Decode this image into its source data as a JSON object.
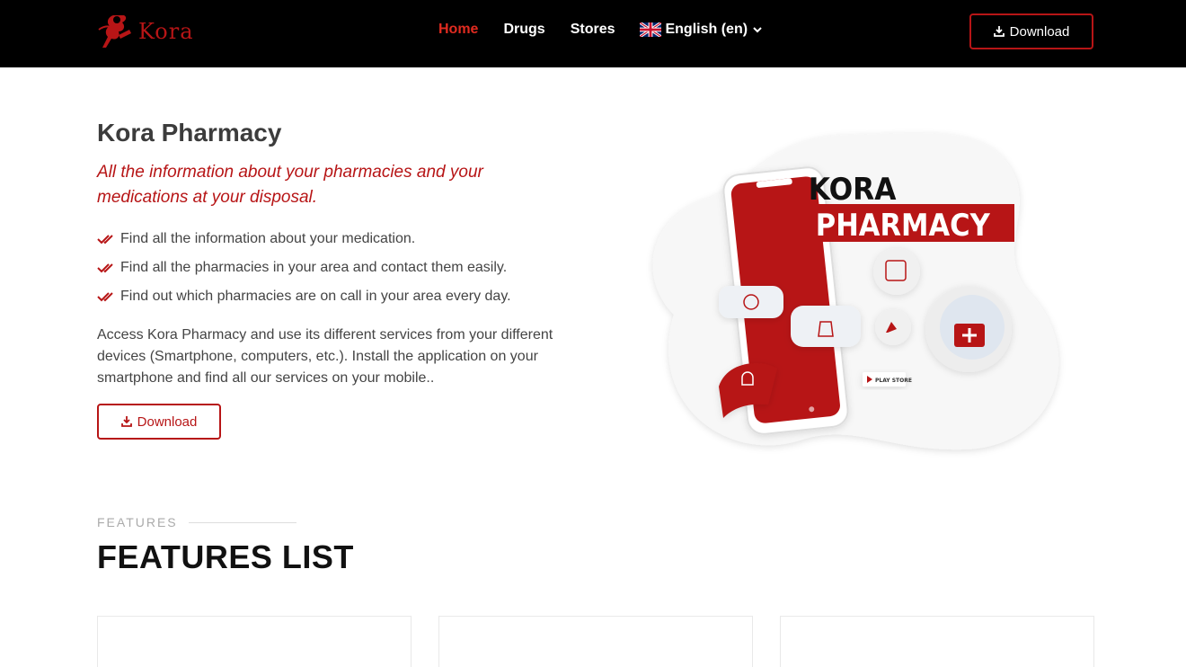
{
  "header": {
    "logo_text": "Kora",
    "nav": [
      {
        "label": "Home",
        "active": true
      },
      {
        "label": "Drugs",
        "active": false
      },
      {
        "label": "Stores",
        "active": false
      }
    ],
    "language_label": "English (en)",
    "download_label": "Download"
  },
  "hero": {
    "title": "Kora Pharmacy",
    "subtitle": "All the information about your pharmacies and your medications at your disposal.",
    "checks": [
      "Find all the information about your medication.",
      "Find all the pharmacies in your area and contact them easily.",
      "Find out which pharmacies are on call in your area every day."
    ],
    "description": "Access Kora Pharmacy and use its different services from your different devices (Smartphone, computers, etc.). Install the application on your smartphone and find all our services on your mobile..",
    "download_label": "Download"
  },
  "illustration": {
    "line1": "KORA",
    "line2": "PHARMACY",
    "store_badge": "PLAY STORE"
  },
  "features": {
    "kicker": "FEATURES",
    "title": "FEATURES LIST"
  },
  "colors": {
    "brand_red": "#b71516",
    "active_nav": "#e02b20",
    "header_bg": "#000000"
  }
}
